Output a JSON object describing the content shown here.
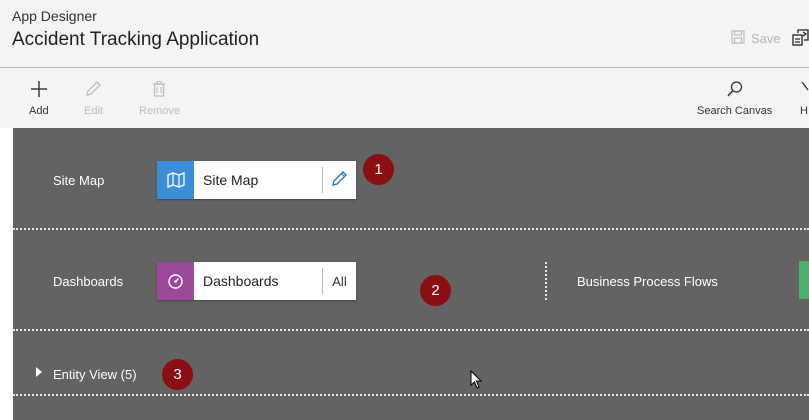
{
  "header": {
    "app_designer_label": "App Designer",
    "app_title": "Accident Tracking Application",
    "save_label": "Save"
  },
  "commands": {
    "add": "Add",
    "edit": "Edit",
    "remove": "Remove",
    "search_canvas": "Search Canvas",
    "partial_next": "H"
  },
  "canvas": {
    "site_map_row_label": "Site Map",
    "site_map_tile_label": "Site Map",
    "dashboards_row_label": "Dashboards",
    "dashboards_tile_label": "Dashboards",
    "dashboards_tile_action": "All",
    "bpf_label": "Business Process Flows",
    "entity_view_label": "Entity View (5)"
  },
  "badges": [
    "1",
    "2",
    "3"
  ],
  "colors": {
    "canvas_bg": "#636363",
    "site_map_icon_bg": "#3b8fd9",
    "dashboard_icon_bg": "#9b4a9b",
    "badge_bg": "#8b0e12",
    "bpf_tile": "#4caf6d"
  },
  "icons": {
    "add": "plus-icon",
    "edit": "pencil-icon",
    "remove": "trash-icon",
    "search": "search-icon",
    "save": "save-icon",
    "site_map": "map-icon",
    "dashboard": "gauge-icon",
    "entity_expand": "caret-right-icon"
  }
}
